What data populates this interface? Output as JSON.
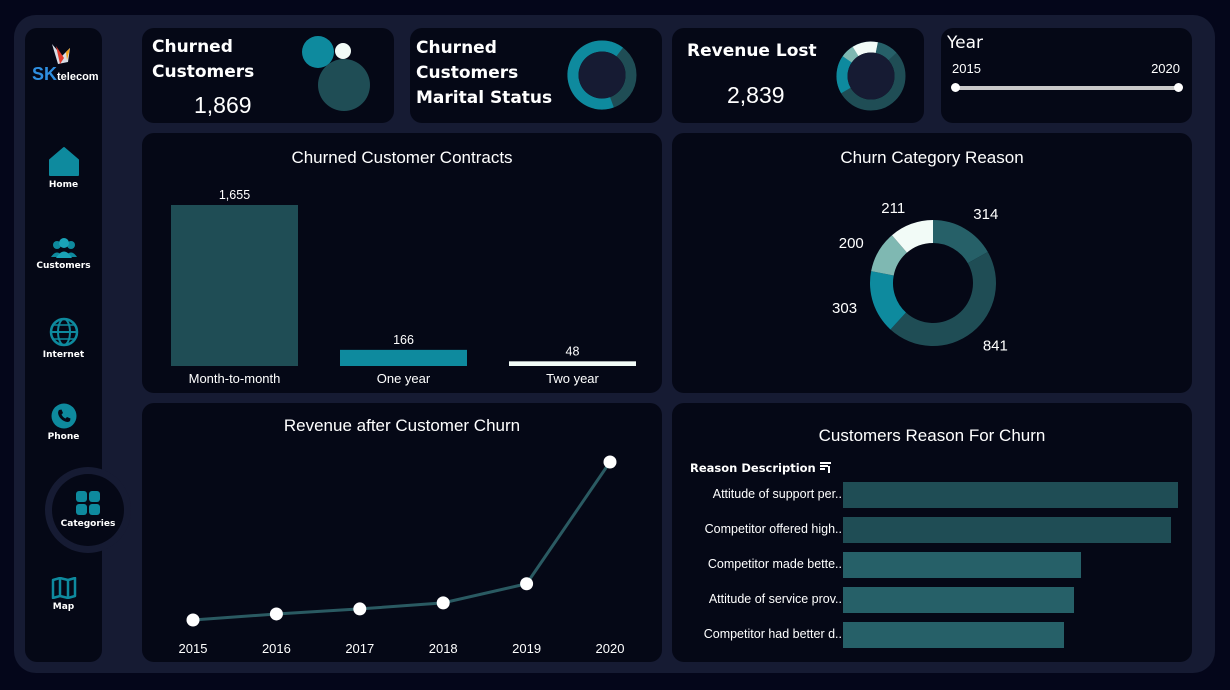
{
  "brand": {
    "logo_text_1": "SK",
    "logo_text_2": "telecom"
  },
  "nav": [
    {
      "label": "Home",
      "icon": "home-icon"
    },
    {
      "label": "Customers",
      "icon": "customers-icon"
    },
    {
      "label": "Internet",
      "icon": "globe-icon"
    },
    {
      "label": "Phone",
      "icon": "phone-icon"
    },
    {
      "label": "Categories",
      "icon": "grid-icon",
      "active": true
    },
    {
      "label": "Map",
      "icon": "map-icon"
    }
  ],
  "kpis": {
    "churned": {
      "title_1": "Churned",
      "title_2": "Customers",
      "value": "1,869"
    },
    "marital": {
      "title_1": "Churned",
      "title_2": "Customers",
      "title_3": "Marital Status"
    },
    "revenue": {
      "title": "Revenue Lost",
      "value": "2,839"
    }
  },
  "year_filter": {
    "title": "Year",
    "min_label": "2015",
    "max_label": "2020",
    "range": [
      0,
      1
    ]
  },
  "colors": {
    "dark_teal": "#1f4d55",
    "mid_teal": "#266068",
    "bright_teal": "#0e8a9e",
    "light_teal": "#7fb8b2",
    "white": "#f2fbf7",
    "line": "#2a5a62"
  },
  "contracts": {
    "title": "Churned Customer Contracts",
    "chart_data": {
      "type": "bar",
      "categories": [
        "Month-to-month",
        "One year",
        "Two year"
      ],
      "values": [
        1655,
        166,
        48
      ],
      "value_labels": [
        "1,655",
        "166",
        "48"
      ]
    }
  },
  "category_reason": {
    "title": "Churn Category Reason",
    "chart_data": {
      "type": "pie",
      "values": [
        314,
        841,
        303,
        200,
        211
      ],
      "labels": [
        "314",
        "841",
        "303",
        "200",
        "211"
      ],
      "colors": [
        "#266068",
        "#1f4d55",
        "#0e8a9e",
        "#7fb8b2",
        "#f2fbf7"
      ]
    }
  },
  "revenue_trend": {
    "title": "Revenue after Customer Churn",
    "chart_data": {
      "type": "line",
      "x": [
        "2015",
        "2016",
        "2017",
        "2018",
        "2019",
        "2020"
      ],
      "y": [
        1,
        7,
        12,
        18,
        37,
        158
      ]
    }
  },
  "reasons": {
    "title": "Customers Reason For Churn",
    "column_header": "Reason Description",
    "sort_icon": "sort-icon",
    "chart_data": {
      "type": "bar",
      "orientation": "horizontal",
      "categories": [
        "Attitude of support per..",
        "Competitor offered high..",
        "Competitor made bette..",
        "Attitude of service prov..",
        "Competitor had better d.."
      ],
      "values": [
        100,
        98,
        71,
        69,
        66
      ]
    }
  }
}
